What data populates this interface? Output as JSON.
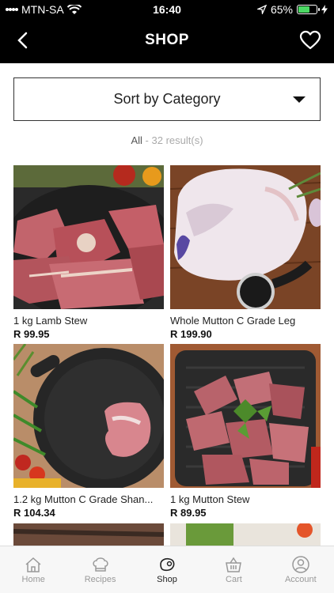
{
  "status": {
    "carrier": "MTN-SA",
    "time": "16:40",
    "battery": "65%",
    "battery_level": 0.65
  },
  "header": {
    "title": "SHOP"
  },
  "sort": {
    "label": "Sort by Category"
  },
  "results": {
    "filter": "All",
    "separator": "-",
    "count": "32 result(s)"
  },
  "products": [
    {
      "name": "1 kg Lamb Stew",
      "price": "R 99.95"
    },
    {
      "name": "Whole Mutton C Grade Leg",
      "price": "R 199.90"
    },
    {
      "name": "1.2 kg Mutton C Grade Shan...",
      "price": "R 104.34"
    },
    {
      "name": "1 kg Mutton Stew",
      "price": "R 89.95"
    }
  ],
  "tabs": [
    {
      "label": "Home",
      "icon": "home-icon"
    },
    {
      "label": "Recipes",
      "icon": "chef-hat-icon"
    },
    {
      "label": "Shop",
      "icon": "meat-icon",
      "active": true
    },
    {
      "label": "Cart",
      "icon": "basket-icon"
    },
    {
      "label": "Account",
      "icon": "user-icon"
    }
  ]
}
